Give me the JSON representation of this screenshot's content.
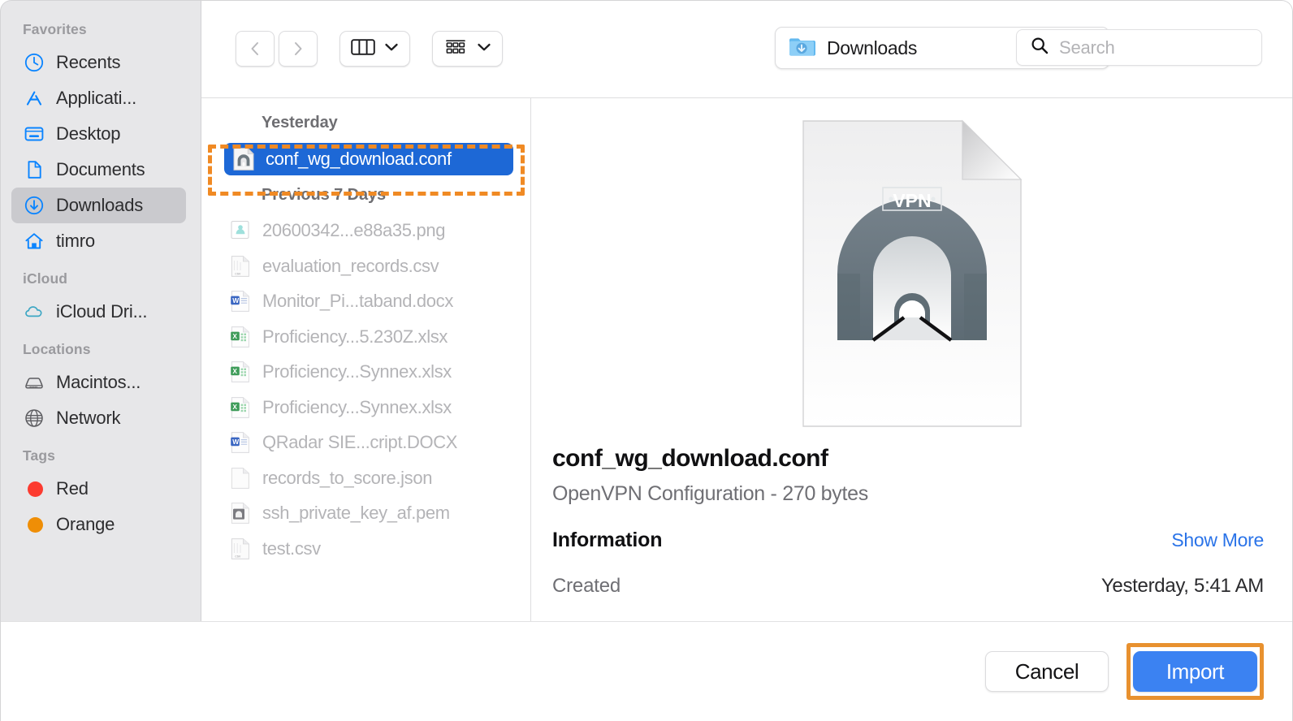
{
  "sidebar": {
    "groups": [
      {
        "title": "Favorites",
        "items": [
          {
            "label": "Recents",
            "icon": "clock-icon"
          },
          {
            "label": "Applicati...",
            "icon": "applications-icon"
          },
          {
            "label": "Desktop",
            "icon": "desktop-icon"
          },
          {
            "label": "Documents",
            "icon": "document-icon"
          },
          {
            "label": "Downloads",
            "icon": "downloads-icon",
            "selected": true
          },
          {
            "label": "timro",
            "icon": "home-icon"
          }
        ]
      },
      {
        "title": "iCloud",
        "items": [
          {
            "label": "iCloud Dri...",
            "icon": "cloud-icon"
          }
        ]
      },
      {
        "title": "Locations",
        "items": [
          {
            "label": "Macintos...",
            "icon": "harddisk-icon"
          },
          {
            "label": "Network",
            "icon": "globe-icon"
          }
        ]
      },
      {
        "title": "Tags",
        "items": [
          {
            "label": "Red",
            "icon": "tag-dot-icon",
            "color": "#fc3b30"
          },
          {
            "label": "Orange",
            "icon": "tag-dot-icon",
            "color": "#ef8e06"
          }
        ]
      }
    ]
  },
  "toolbar": {
    "back_label": "Back",
    "forward_label": "Forward",
    "view_label": "Column View",
    "group_label": "Group By",
    "path": "Downloads",
    "path_icon": "downloads-folder-icon"
  },
  "search": {
    "placeholder": "Search",
    "value": "",
    "icon": "search-icon"
  },
  "filelist": {
    "groups": [
      {
        "header": "Yesterday",
        "files": [
          {
            "name": "conf_wg_download.conf",
            "icon": "vpn-config-icon",
            "selected": true
          }
        ]
      },
      {
        "header": "Previous 7 Days",
        "files": [
          {
            "name": "20600342...e88a35.png",
            "icon": "image-icon"
          },
          {
            "name": "evaluation_records.csv",
            "icon": "csv-icon"
          },
          {
            "name": "Monitor_Pi...taband.docx",
            "icon": "word-icon"
          },
          {
            "name": "Proficiency...5.230Z.xlsx",
            "icon": "excel-icon"
          },
          {
            "name": "Proficiency...Synnex.xlsx",
            "icon": "excel-icon"
          },
          {
            "name": "Proficiency...Synnex.xlsx",
            "icon": "excel-icon"
          },
          {
            "name": "QRadar SIE...cript.DOCX",
            "icon": "word-icon"
          },
          {
            "name": "records_to_score.json",
            "icon": "plain-doc-icon"
          },
          {
            "name": "ssh_private_key_af.pem",
            "icon": "pem-icon"
          },
          {
            "name": "test.csv",
            "icon": "csv-icon"
          }
        ]
      }
    ]
  },
  "preview": {
    "icon_label": "VPN",
    "file_name": "conf_wg_download.conf",
    "file_kind_size": "OpenVPN Configuration - 270 bytes",
    "information_header": "Information",
    "show_more": "Show More",
    "meta": [
      {
        "key": "Created",
        "value": "Yesterday, 5:41 AM"
      }
    ]
  },
  "footer": {
    "cancel_label": "Cancel",
    "import_label": "Import"
  },
  "colors": {
    "accent_blue": "#3b82f2",
    "selection_blue": "#1d68d6",
    "annotation_orange": "#e8912f",
    "sidebar_bg": "#e7e7e9",
    "link_blue": "#2a73e8"
  }
}
